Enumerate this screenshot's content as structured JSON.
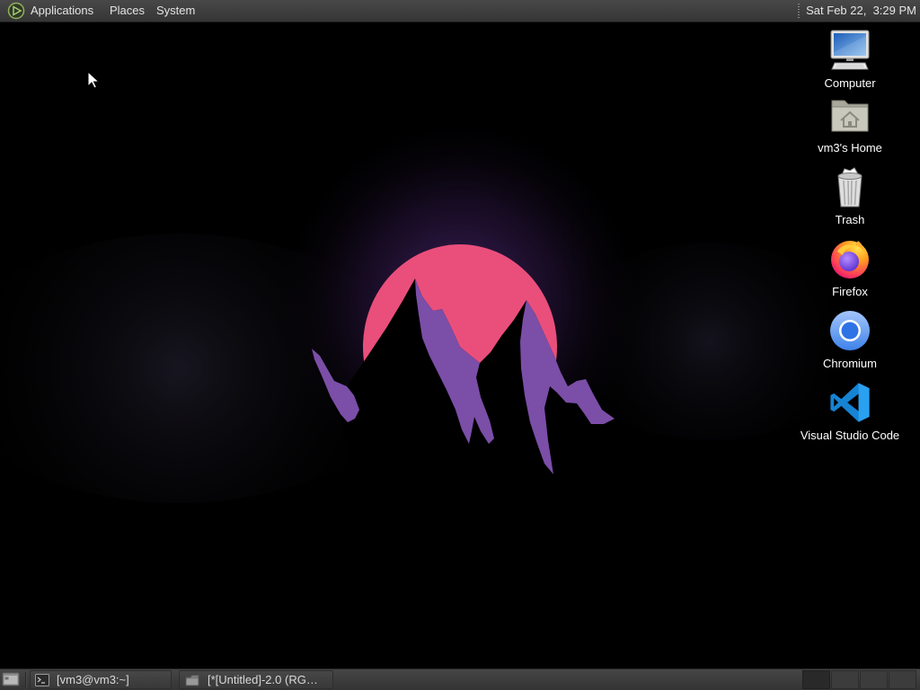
{
  "top_panel": {
    "logo_icon": "main-menu-logo-icon",
    "menus": [
      {
        "label": "Applications"
      },
      {
        "label": "Places"
      },
      {
        "label": "System"
      }
    ],
    "clock": "Sat Feb 22,  3:29 PM"
  },
  "desktop": {
    "icons": [
      {
        "label": "Computer",
        "icon": "computer-icon"
      },
      {
        "label": "vm3's Home",
        "icon": "home-folder-icon"
      },
      {
        "label": "Trash",
        "icon": "trash-icon"
      },
      {
        "label": "Firefox",
        "icon": "firefox-icon"
      },
      {
        "label": "Chromium",
        "icon": "chromium-icon"
      },
      {
        "label": "Visual Studio Code",
        "icon": "vscode-icon"
      }
    ],
    "wallpaper": {
      "background": "#000000",
      "sun_color": "#ea4f7c",
      "mountain_highlight_color": "#7b4ea8",
      "glow_color": "#5a2f86"
    }
  },
  "bottom_panel": {
    "show_desktop_icon": "show-desktop-icon",
    "tasks": [
      {
        "label": "[vm3@vm3:~]",
        "icon": "terminal-icon"
      },
      {
        "label": "[*[Untitled]-2.0 (RG…",
        "icon": "image-editor-icon"
      }
    ],
    "workspace_switcher": {
      "workspaces": 4,
      "active": 1
    }
  },
  "colors": {
    "panel_background": "#3a3a3a",
    "panel_text": "#e4e4e4",
    "desktop_label_text": "#ffffff"
  }
}
